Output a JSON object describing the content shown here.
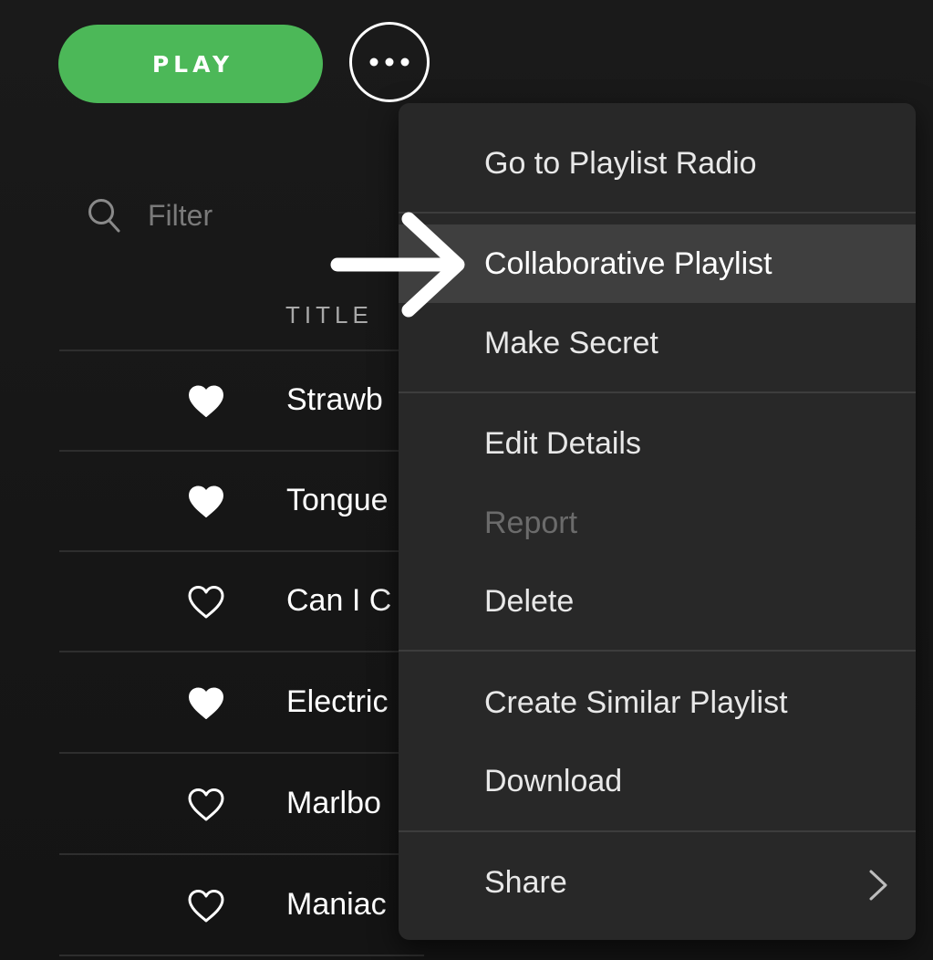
{
  "toolbar": {
    "play_label": "PLAY",
    "more_icon": "more-horizontal-icon"
  },
  "filter": {
    "placeholder": "Filter",
    "icon": "search-icon"
  },
  "table": {
    "title_header": "TITLE",
    "rows": [
      {
        "title": "Strawb",
        "liked": true
      },
      {
        "title": "Tongue",
        "liked": true
      },
      {
        "title": "Can I C",
        "liked": false
      },
      {
        "title": "Electric",
        "liked": true
      },
      {
        "title": "Marlbo",
        "liked": false
      },
      {
        "title": "Maniac",
        "liked": false
      }
    ]
  },
  "menu": {
    "items": [
      {
        "label": "Go to Playlist Radio",
        "state": "normal"
      },
      {
        "label": "Collaborative Playlist",
        "state": "highlighted"
      },
      {
        "label": "Make Secret",
        "state": "normal"
      },
      {
        "label": "Edit Details",
        "state": "normal"
      },
      {
        "label": "Report",
        "state": "disabled"
      },
      {
        "label": "Delete",
        "state": "normal"
      },
      {
        "label": "Create Similar Playlist",
        "state": "normal"
      },
      {
        "label": "Download",
        "state": "normal"
      },
      {
        "label": "Share",
        "state": "normal",
        "has_submenu": true
      }
    ]
  },
  "colors": {
    "accent": "#4cb858",
    "background": "#161616",
    "menu_background": "#282828",
    "menu_highlight": "#3f3f3f"
  },
  "annotation": {
    "icon": "arrow-right-icon"
  }
}
